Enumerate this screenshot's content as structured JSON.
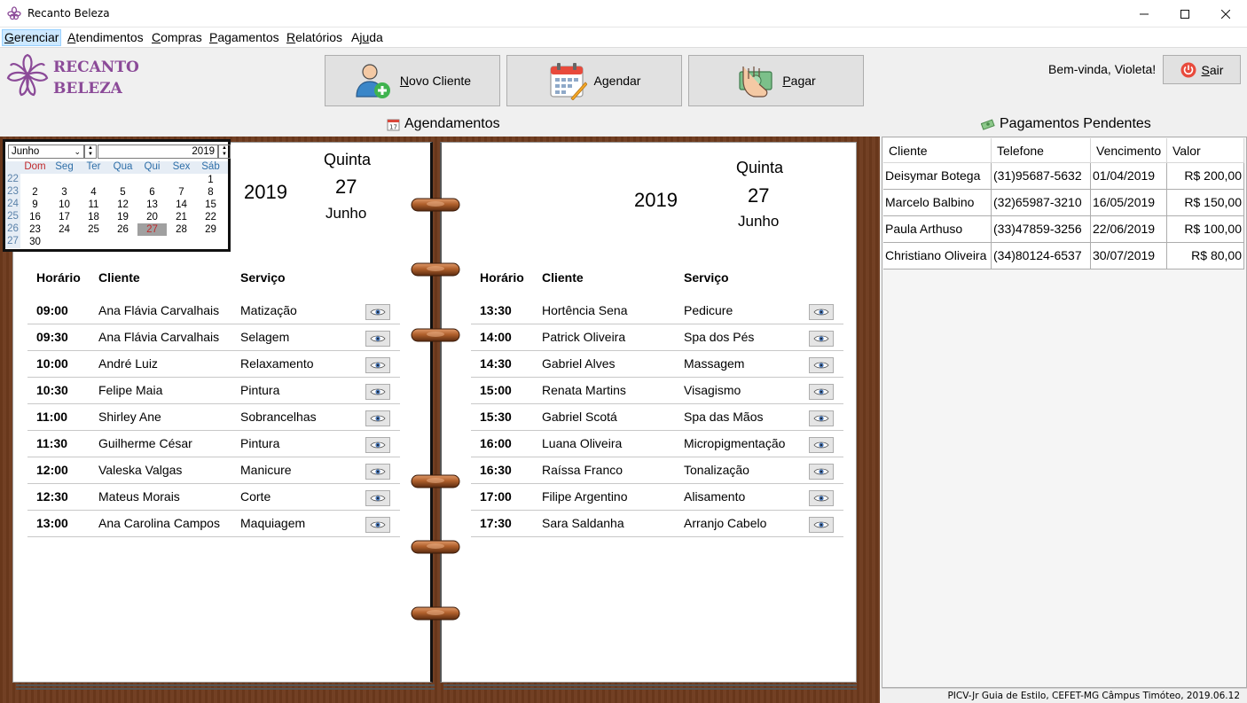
{
  "window": {
    "title": "Recanto Beleza"
  },
  "menu": [
    {
      "label": "Gerenciar",
      "key": "G",
      "rest": "erenciar"
    },
    {
      "label": "Atendimentos",
      "key": "A",
      "rest": "tendimentos"
    },
    {
      "label": "Compras",
      "key": "C",
      "rest": "ompras"
    },
    {
      "label": "Pagamentos",
      "key": "P",
      "rest": "agamentos"
    },
    {
      "label": "Relatórios",
      "key": "R",
      "rest": "elatórios"
    },
    {
      "label": "Ajuda",
      "pre": "Aj",
      "key": "u",
      "rest": "da"
    }
  ],
  "logo": {
    "line1": "RECANTO",
    "line2": "BELEZA"
  },
  "toolbar": {
    "novo_cliente": {
      "key": "N",
      "rest": "ovo Cliente",
      "icon": "user-add-icon"
    },
    "agendar": {
      "pre": "A",
      "key": "g",
      "rest": "endar",
      "icon": "calendar-icon"
    },
    "pagar": {
      "key": "P",
      "rest": "agar",
      "icon": "payment-icon"
    }
  },
  "header": {
    "welcome": "Bem-vinda, Violeta!",
    "sair": {
      "key": "S",
      "rest": "air"
    }
  },
  "sections": {
    "agendamentos": "Agendamentos",
    "pagamentos": "Pagamentos Pendentes"
  },
  "calendar": {
    "month": "Junho",
    "year": "2019",
    "weekdays": [
      "Dom",
      "Seg",
      "Ter",
      "Qua",
      "Qui",
      "Sex",
      "Sáb"
    ],
    "weeks": [
      {
        "n": "22",
        "days": [
          "",
          "",
          "",
          "",
          "",
          "",
          "1"
        ]
      },
      {
        "n": "23",
        "days": [
          "2",
          "3",
          "4",
          "5",
          "6",
          "7",
          "8"
        ]
      },
      {
        "n": "24",
        "days": [
          "9",
          "10",
          "11",
          "12",
          "13",
          "14",
          "15"
        ]
      },
      {
        "n": "25",
        "days": [
          "16",
          "17",
          "18",
          "19",
          "20",
          "21",
          "22"
        ]
      },
      {
        "n": "26",
        "days": [
          "23",
          "24",
          "25",
          "26",
          "27",
          "28",
          "29"
        ]
      },
      {
        "n": "27",
        "days": [
          "30",
          "",
          "",
          "",
          "",
          "",
          ""
        ]
      }
    ],
    "selected": "27"
  },
  "left_page": {
    "year": "2019",
    "weekday": "Quinta",
    "day": "27",
    "month": "Junho",
    "columns": [
      "Horário",
      "Cliente",
      "Serviço"
    ],
    "rows": [
      [
        "09:00",
        "Ana Flávia Carvalhais",
        "Matização"
      ],
      [
        "09:30",
        "Ana Flávia Carvalhais",
        "Selagem"
      ],
      [
        "10:00",
        "André Luiz",
        "Relaxamento"
      ],
      [
        "10:30",
        "Felipe Maia",
        "Pintura"
      ],
      [
        "11:00",
        "Shirley Ane",
        "Sobrancelhas"
      ],
      [
        "11:30",
        "Guilherme César",
        "Pintura"
      ],
      [
        "12:00",
        "Valeska Valgas",
        "Manicure"
      ],
      [
        "12:30",
        "Mateus Morais",
        "Corte"
      ],
      [
        "13:00",
        "Ana Carolina Campos",
        "Maquiagem"
      ]
    ]
  },
  "right_page": {
    "year": "2019",
    "weekday": "Quinta",
    "day": "27",
    "month": "Junho",
    "columns": [
      "Horário",
      "Cliente",
      "Serviço"
    ],
    "rows": [
      [
        "13:30",
        "Hortência Sena",
        "Pedicure"
      ],
      [
        "14:00",
        "Patrick Oliveira",
        "Spa dos Pés"
      ],
      [
        "14:30",
        "Gabriel Alves",
        "Massagem"
      ],
      [
        "15:00",
        "Renata Martins",
        "Visagismo"
      ],
      [
        "15:30",
        "Gabriel Scotá",
        "Spa das Mãos"
      ],
      [
        "16:00",
        "Luana Oliveira",
        "Micropigmentação"
      ],
      [
        "16:30",
        "Raíssa Franco",
        "Tonalização"
      ],
      [
        "17:00",
        "Filipe Argentino",
        "Alisamento"
      ],
      [
        "17:30",
        "Sara Saldanha",
        "Arranjo Cabelo"
      ]
    ]
  },
  "payments": {
    "columns": [
      "Cliente",
      "Telefone",
      "Vencimento",
      "Valor"
    ],
    "rows": [
      [
        "Deisymar Botega",
        "(31)95687-5632",
        "01/04/2019",
        "R$ 200,00"
      ],
      [
        "Marcelo Balbino",
        "(32)65987-3210",
        "16/05/2019",
        "R$ 150,00"
      ],
      [
        "Paula Arthuso",
        "(33)47859-3256",
        "22/06/2019",
        "R$ 100,00"
      ],
      [
        "Christiano Oliveira",
        "(34)80124-6537",
        "30/07/2019",
        "R$ 80,00"
      ]
    ]
  },
  "status": "PICV-Jr Guia de Estilo, CEFET-MG Câmpus Timóteo, 2019.06.12",
  "colors": {
    "brand": "#8b4a98",
    "wood": "#6e3a1d",
    "calendar_header": "#2f6fa8",
    "sunday": "#c0292b"
  }
}
